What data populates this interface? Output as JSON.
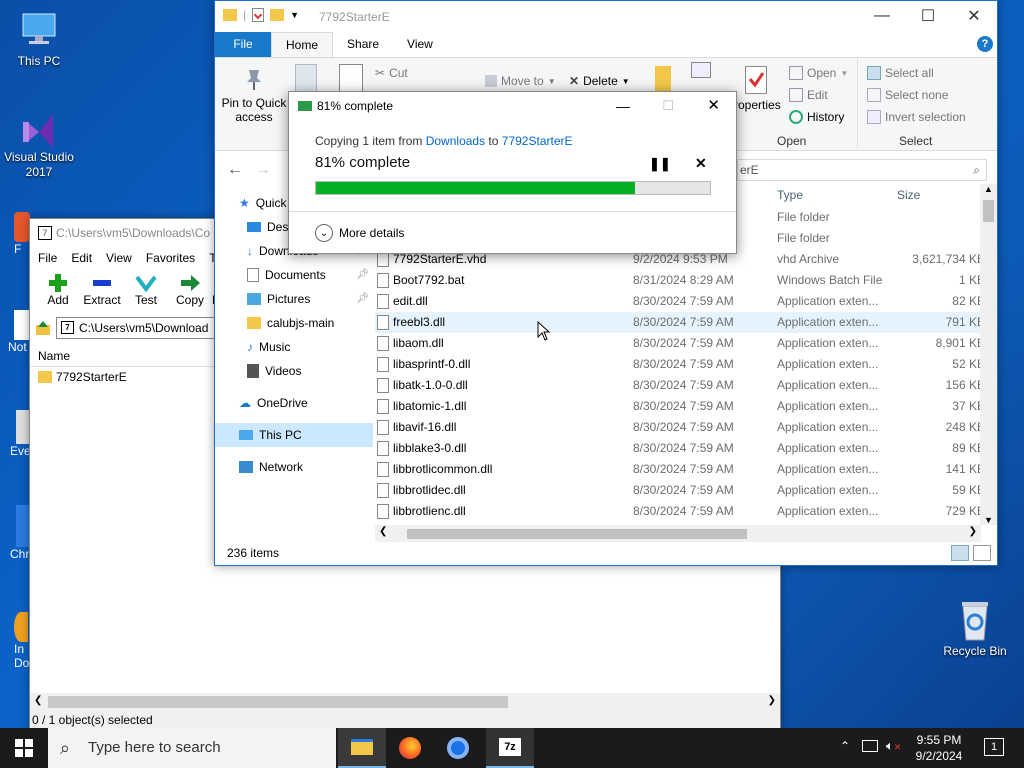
{
  "desktop": {
    "icons": [
      {
        "label": "This PC",
        "icon": "this-pc-icon"
      },
      {
        "label": "Visual Studio 2017",
        "icon": "visual-studio-icon"
      },
      {
        "label": "Recycle Bin",
        "icon": "recycle-bin-icon"
      }
    ],
    "partial_labels": [
      "F",
      "Not",
      "Eve",
      "Chr",
      "In",
      "Do"
    ]
  },
  "zip": {
    "title": "C:\\Users\\vm5\\Downloads\\Co",
    "menu": [
      "File",
      "Edit",
      "View",
      "Favorites",
      "To"
    ],
    "tools": [
      "Add",
      "Extract",
      "Test",
      "Copy",
      "M"
    ],
    "address": "C:\\Users\\vm5\\Download",
    "column_name": "Name",
    "items": [
      "7792StarterE"
    ],
    "status": "0 / 1 object(s) selected"
  },
  "explorer": {
    "window_title": "7792StarterE",
    "tabs": [
      "File",
      "Home",
      "Share",
      "View"
    ],
    "ribbon": {
      "pin": "Pin to Quick access",
      "cut": "Cut",
      "move_to": "Move to",
      "delete": "Delete",
      "properties": "roperties",
      "open": "Open",
      "edit": "Edit",
      "history": "History",
      "select_all": "Select all",
      "select_none": "Select none",
      "invert": "Invert selection",
      "group_open": "Open",
      "group_select": "Select"
    },
    "search_text": "erE",
    "nav_pane": [
      {
        "label": "Quick",
        "icon": "star-icon"
      },
      {
        "label": "Desk",
        "icon": "desktop-icon"
      },
      {
        "label": "Downloads",
        "icon": "downloads-icon"
      },
      {
        "label": "Documents",
        "icon": "documents-icon"
      },
      {
        "label": "Pictures",
        "icon": "pictures-icon"
      },
      {
        "label": "calubjs-main",
        "icon": "folder-icon"
      },
      {
        "label": "Music",
        "icon": "music-icon"
      },
      {
        "label": "Videos",
        "icon": "videos-icon"
      },
      {
        "label": "OneDrive",
        "icon": "onedrive-icon"
      },
      {
        "label": "This PC",
        "icon": "this-pc-icon"
      },
      {
        "label": "Network",
        "icon": "network-icon"
      }
    ],
    "columns": {
      "type": "Type",
      "size": "Size"
    },
    "rows": [
      {
        "name": "",
        "date": "",
        "type": "File folder",
        "size": ""
      },
      {
        "name": "",
        "date": "",
        "type": "File folder",
        "size": ""
      },
      {
        "name": "7792StarterE.vhd",
        "date": "9/2/2024 9:53 PM",
        "type": "vhd Archive",
        "size": "3,621,734 KB"
      },
      {
        "name": "Boot7792.bat",
        "date": "8/31/2024 8:29 AM",
        "type": "Windows Batch File",
        "size": "1 KB"
      },
      {
        "name": "edit.dll",
        "date": "8/30/2024 7:59 AM",
        "type": "Application exten...",
        "size": "82 KB"
      },
      {
        "name": "freebl3.dll",
        "date": "8/30/2024 7:59 AM",
        "type": "Application exten...",
        "size": "791 KB"
      },
      {
        "name": "libaom.dll",
        "date": "8/30/2024 7:59 AM",
        "type": "Application exten...",
        "size": "8,901 KB"
      },
      {
        "name": "libasprintf-0.dll",
        "date": "8/30/2024 7:59 AM",
        "type": "Application exten...",
        "size": "52 KB"
      },
      {
        "name": "libatk-1.0-0.dll",
        "date": "8/30/2024 7:59 AM",
        "type": "Application exten...",
        "size": "156 KB"
      },
      {
        "name": "libatomic-1.dll",
        "date": "8/30/2024 7:59 AM",
        "type": "Application exten...",
        "size": "37 KB"
      },
      {
        "name": "libavif-16.dll",
        "date": "8/30/2024 7:59 AM",
        "type": "Application exten...",
        "size": "248 KB"
      },
      {
        "name": "libblake3-0.dll",
        "date": "8/30/2024 7:59 AM",
        "type": "Application exten...",
        "size": "89 KB"
      },
      {
        "name": "libbrotlicommon.dll",
        "date": "8/30/2024 7:59 AM",
        "type": "Application exten...",
        "size": "141 KB"
      },
      {
        "name": "libbrotlidec.dll",
        "date": "8/30/2024 7:59 AM",
        "type": "Application exten...",
        "size": "59 KB"
      },
      {
        "name": "libbrotlienc.dll",
        "date": "8/30/2024 7:59 AM",
        "type": "Application exten...",
        "size": "729 KB"
      }
    ],
    "status": "236 items"
  },
  "dialog": {
    "title": "81% complete",
    "copying_prefix": "Copying 1 item from ",
    "source": "Downloads",
    "to": " to ",
    "dest": "7792StarterE",
    "big": "81% complete",
    "progress": 0.81,
    "more": "More details",
    "color": "#06b025"
  },
  "taskbar": {
    "search_placeholder": "Type here to search",
    "time": "9:55 PM",
    "date": "9/2/2024",
    "notif_count": "1"
  }
}
